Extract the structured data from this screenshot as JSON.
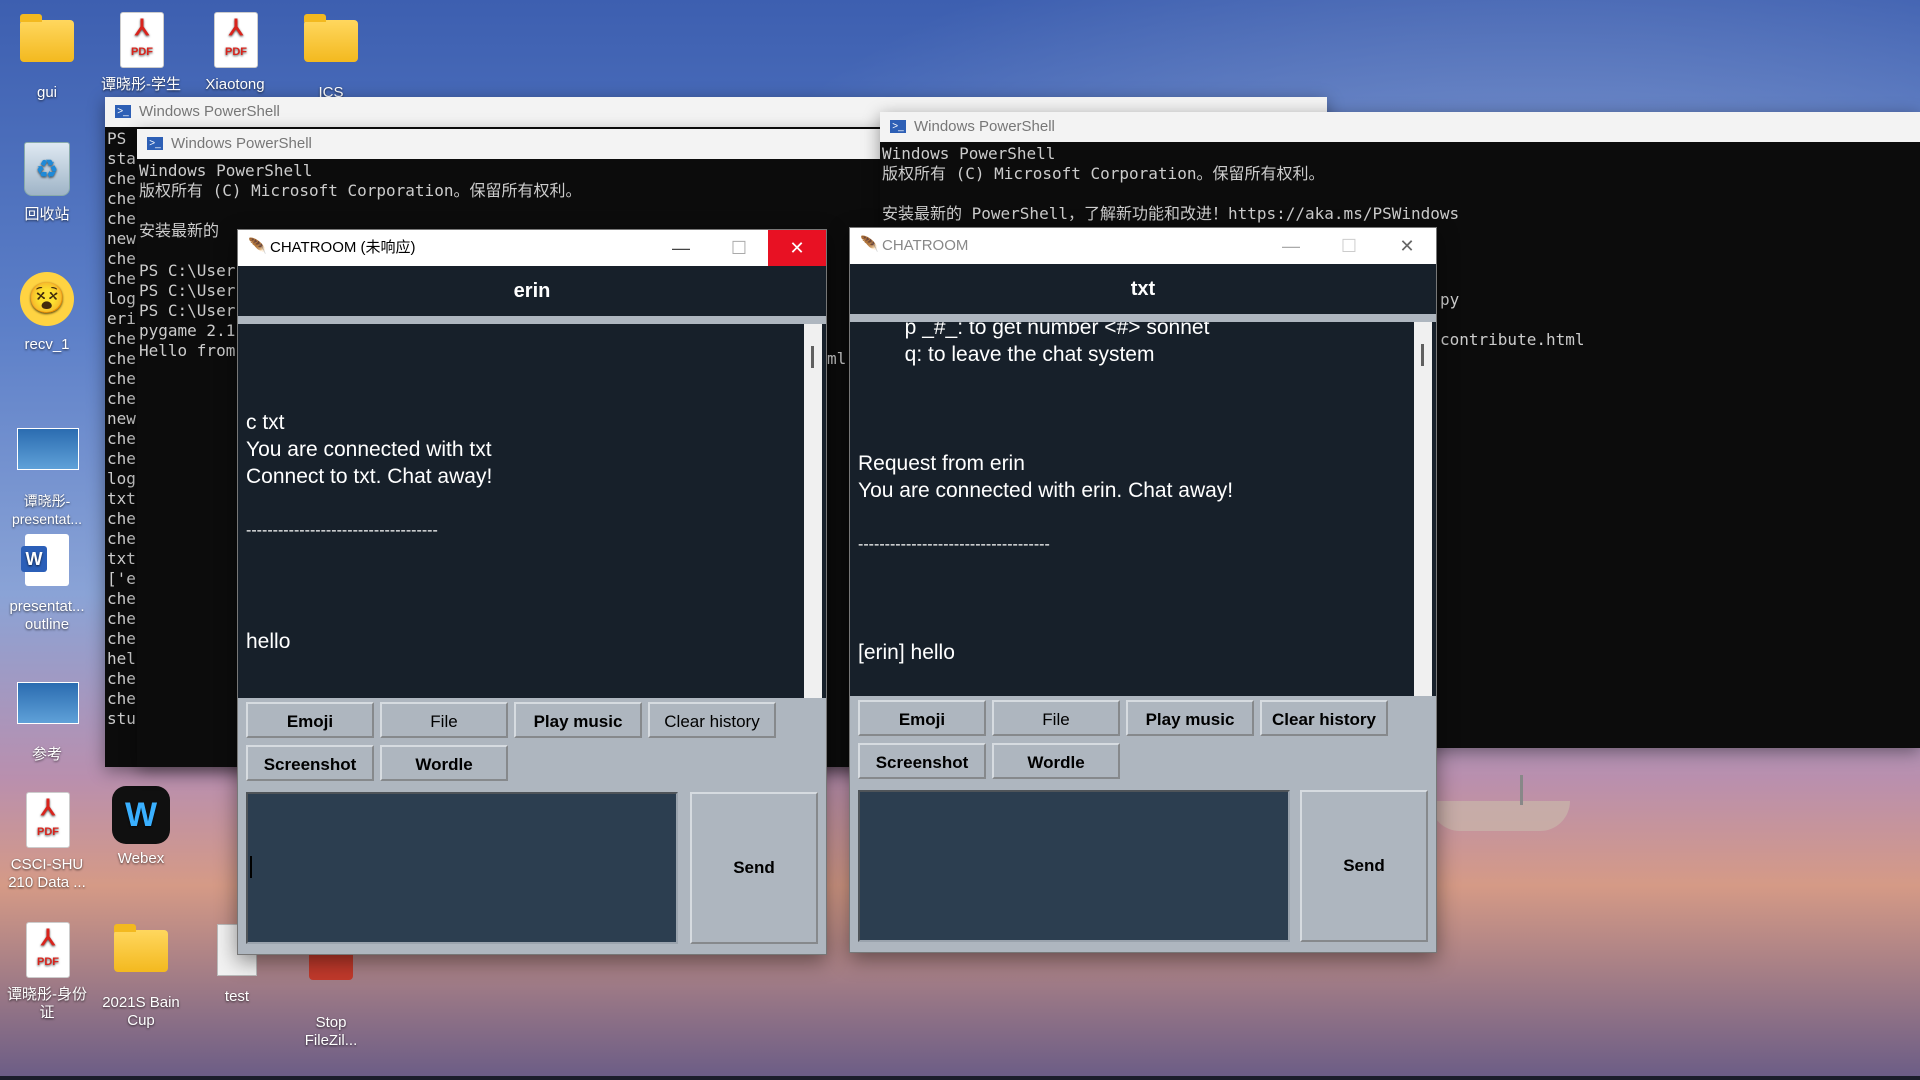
{
  "desktop": {
    "icons": [
      {
        "label": "gui"
      },
      {
        "label": "谭晓彤-学生"
      },
      {
        "label": "Xiaotong"
      },
      {
        "label": "ICS"
      },
      {
        "label": "回收站"
      },
      {
        "label": "recv_1"
      },
      {
        "label": "谭晓彤-presentat..."
      },
      {
        "label": "presentat... outline"
      },
      {
        "label": "参考"
      },
      {
        "label": "CSCI-SHU 210 Data ..."
      },
      {
        "label": "Webex"
      },
      {
        "label": "谭晓彤-身份证"
      },
      {
        "label": "2021S Bain Cup"
      },
      {
        "label": "test"
      },
      {
        "label": "Stop FileZil..."
      }
    ]
  },
  "powershell_back": {
    "title": "Windows PowerShell",
    "gutter": "PS\nsta\nche\nche\nche\nnew\nche\nche\nlog\neri\nche\nche\nche\nche\nnew\nche\nche\nlog\ntxt\nche\nche\ntxt\n['e\nche\nche\nche\nhel\nche\nche\nstu"
  },
  "powershell_mid": {
    "title": "Windows PowerShell",
    "body": "Windows PowerShell\n版权所有 (C) Microsoft Corporation。保留所有权利。\n\n安装最新的\n\nPS C:\\User\nPS C:\\User\nPS C:\\User\npygame 2.1\nHello from",
    "tail": "ml"
  },
  "powershell_right": {
    "title": "Windows PowerShell",
    "body": "Windows PowerShell\n版权所有 (C) Microsoft Corporation。保留所有权利。\n\n安装最新的 PowerShell，了解新功能和改进！https://aka.ms/PSWindows",
    "fragment1": "py",
    "fragment2": "contribute.html"
  },
  "chat_left": {
    "window_title": "CHATROOM (未响应)",
    "header": "erin",
    "lines": [
      "c txt",
      "You are connected with txt",
      "Connect to txt. Chat away!",
      "",
      "------------------------------------",
      "",
      "",
      "",
      "hello"
    ],
    "buttons": {
      "emoji": "Emoji",
      "file": "File",
      "play_music": "Play music",
      "clear_history": "Clear history",
      "screenshot": "Screenshot",
      "wordle": "Wordle"
    },
    "send": "Send",
    "controls": {
      "minimize": "—",
      "maximize": "☐",
      "close": "✕"
    }
  },
  "chat_right": {
    "window_title": "CHATROOM",
    "header": "txt",
    "lines": [
      "        p _#_: to get number <#> sonnet",
      "        q: to leave the chat system",
      "",
      "",
      "",
      "Request from erin",
      "You are connected with erin. Chat away!",
      "",
      "------------------------------------",
      "",
      "",
      "",
      "[erin] hello"
    ],
    "buttons": {
      "emoji": "Emoji",
      "file": "File",
      "play_music": "Play music",
      "clear_history": "Clear history",
      "screenshot": "Screenshot",
      "wordle": "Wordle"
    },
    "send": "Send",
    "controls": {
      "minimize": "—",
      "maximize": "☐",
      "close": "✕"
    }
  }
}
